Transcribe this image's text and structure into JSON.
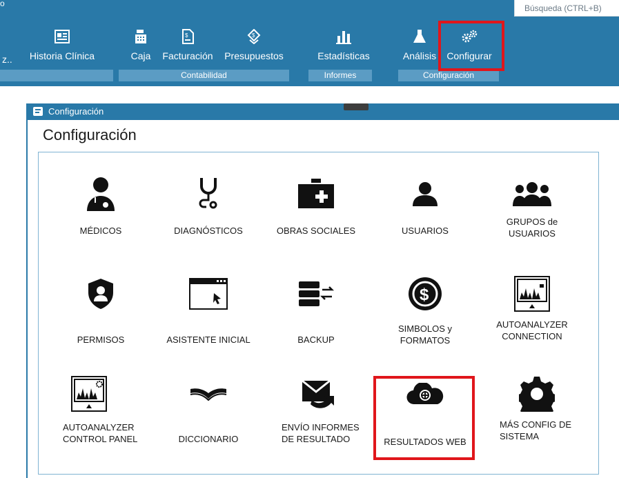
{
  "search": {
    "placeholder": "Búsqueda (CTRL+B)"
  },
  "ribbon": {
    "cut_label": "z..",
    "buttons": {
      "historia": "Historia Clínica",
      "caja": "Caja",
      "facturacion": "Facturación",
      "presupuestos": "Presupuestos",
      "estadisticas": "Estadísticas",
      "analisis": "Análisis",
      "configurar": "Configurar"
    },
    "groups": {
      "contabilidad": "Contabilidad",
      "informes": "Informes",
      "configuracion": "Configuración"
    }
  },
  "window": {
    "title": "Configuración",
    "heading": "Configuración"
  },
  "tiles": {
    "medicos": "MÉDICOS",
    "diagnosticos": "DIAGNÓSTICOS",
    "obras": "OBRAS SOCIALES",
    "usuarios": "USUARIOS",
    "grupos": "GRUPOS de\nUSUARIOS",
    "permisos": "PERMISOS",
    "asistente": "ASISTENTE INICIAL",
    "backup": "BACKUP",
    "simbolos": "SIMBOLOS y\nFORMATOS",
    "autoanalyzer_conn": "AUTOANALYZER\nCONNECTION",
    "autoanalyzer_cp": "AUTOANALYZER\nCONTROL PANEL",
    "diccionario": "DICCIONARIO",
    "envio": "ENVÍO INFORMES\nDE RESULTADO",
    "resultados": "RESULTADOS WEB",
    "mas_config": "MÁS CONFIG DE\nSISTEMA"
  },
  "colors": {
    "ribbon": "#2979a8",
    "highlight": "#e0161b",
    "group_bar": "#5b9cc4"
  }
}
